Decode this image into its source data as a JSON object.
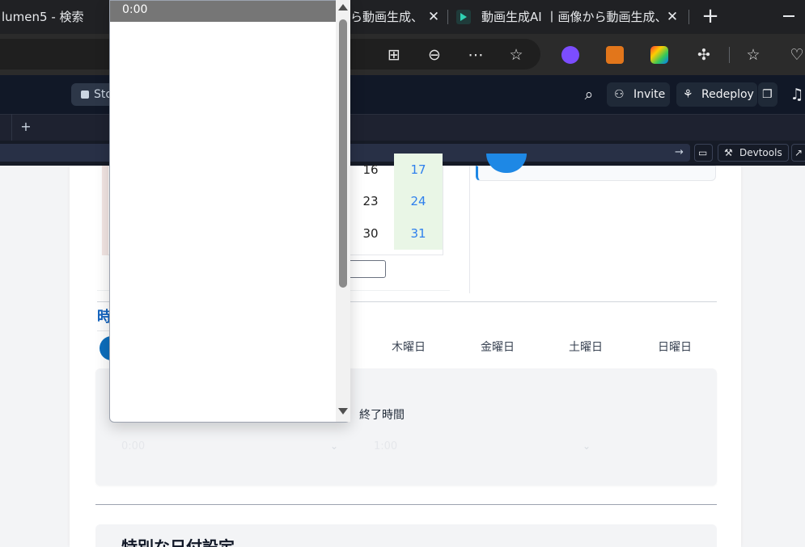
{
  "browser": {
    "tabs": [
      {
        "title": "lumen5 - 検索"
      },
      {
        "title": "ら動画生成、"
      },
      {
        "title": "動画生成AI 丨画像から動画生成、"
      }
    ],
    "close_glyph": "✕",
    "new_tab_glyph": "+"
  },
  "app": {
    "stop_label": "Sto",
    "invite_label": "Invite",
    "redeploy_label": "Redeploy",
    "devtools_label": "Devtools"
  },
  "calendar": {
    "rows": [
      {
        "thu": "16",
        "sun": "17"
      },
      {
        "thu": "23",
        "sun": "24"
      },
      {
        "thu": "30",
        "sun": "31"
      }
    ],
    "sunday_color": "#2f80ed",
    "highlight_color": "#e9f6e6"
  },
  "schedule": {
    "section_title": "時",
    "days": [
      "木曜日",
      "金曜日",
      "土曜日",
      "日曜日"
    ],
    "end_time_label": "終了時間",
    "start_select_value": "0:00",
    "end_select_value": "1:00",
    "accent_color": "#0d6ebd"
  },
  "special": {
    "title": "特別な日付設定"
  },
  "dropdown": {
    "selected_option": "0:00"
  }
}
